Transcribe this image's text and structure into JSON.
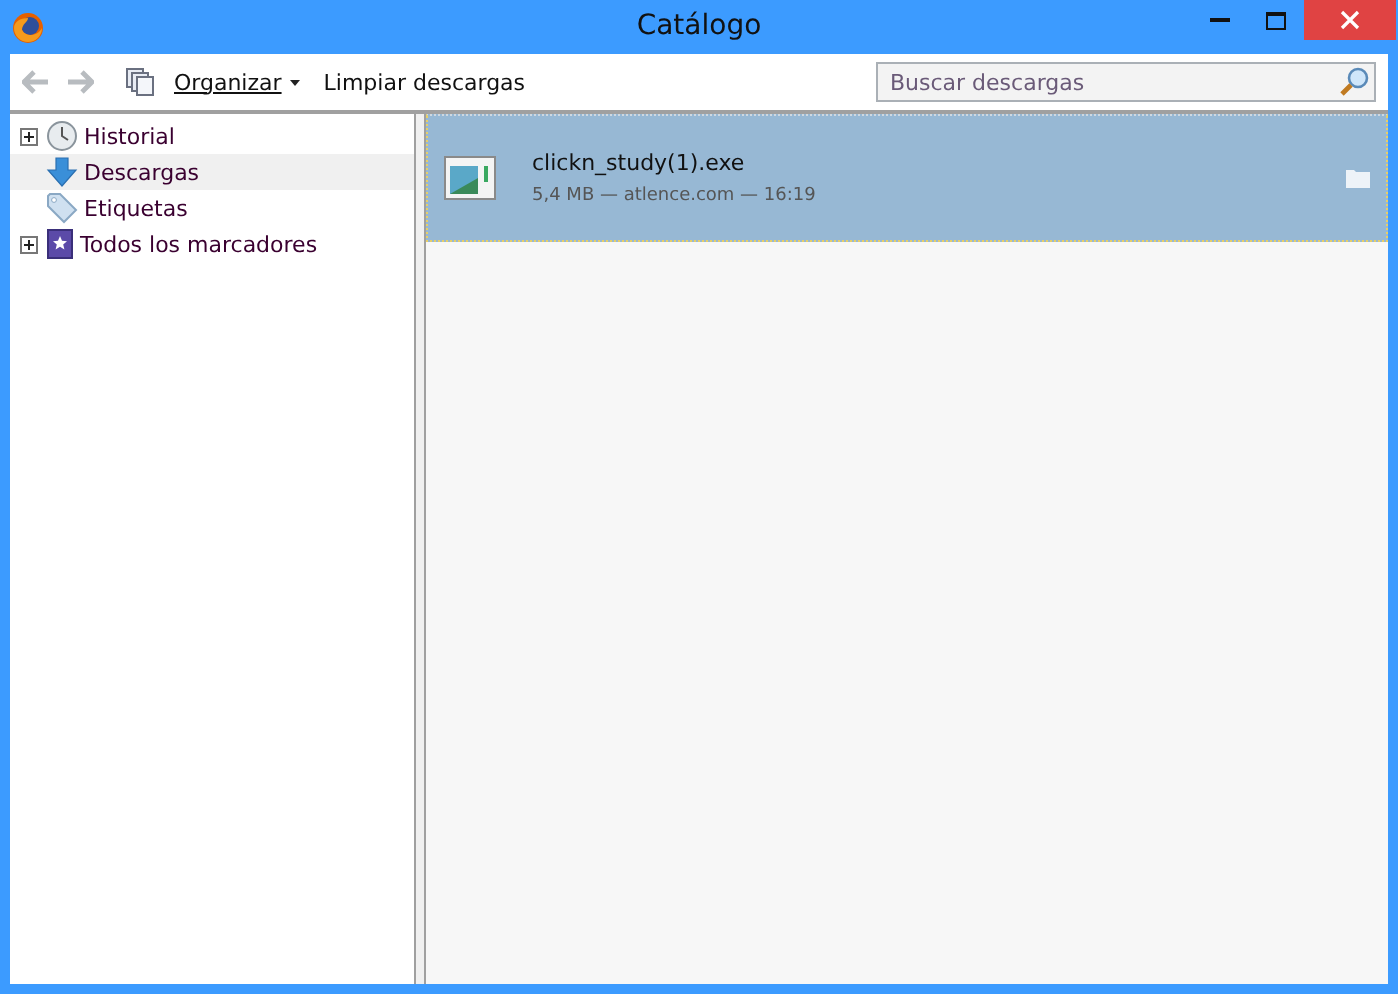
{
  "window": {
    "title": "Catálogo"
  },
  "toolbar": {
    "organize": "Organizar",
    "clear": "Limpiar descargas",
    "search": {
      "placeholder": "Buscar descargas"
    }
  },
  "sidebar": {
    "items": [
      {
        "label": "Historial",
        "kind": "history",
        "expanded": false,
        "selected": false
      },
      {
        "label": "Descargas",
        "kind": "downloads",
        "selected": true
      },
      {
        "label": "Etiquetas",
        "kind": "tags",
        "selected": false
      },
      {
        "label": "Todos los marcadores",
        "kind": "bookmarks",
        "expanded": false,
        "selected": false
      }
    ]
  },
  "downloads": [
    {
      "name": "clickn_study(1).exe",
      "details": "5,4 MB — atlence.com — 16:19",
      "selected": true
    }
  ]
}
